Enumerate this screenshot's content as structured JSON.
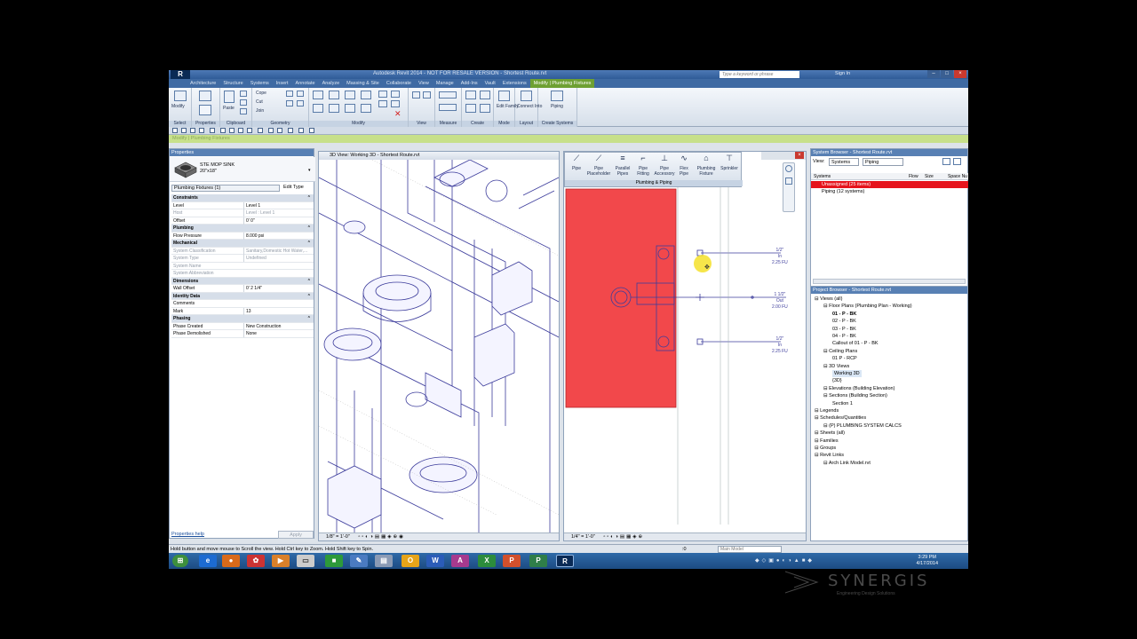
{
  "window": {
    "title": "Autodesk Revit 2014 - NOT FOR RESALE VERSION -   Shortest Route.rvt",
    "search_placeholder": "Type a keyword or phrase",
    "signin": "Sign In"
  },
  "tabs": [
    "Architecture",
    "Structure",
    "Systems",
    "Insert",
    "Annotate",
    "Analyze",
    "Massing & Site",
    "Collaborate",
    "View",
    "Manage",
    "Add-Ins",
    "Vault",
    "Extensions",
    "Modify | Plumbing Fixtures"
  ],
  "ribbon": {
    "modify": "Modify",
    "paste": "Paste",
    "cope": "Cope",
    "cut": "Cut",
    "join": "Join",
    "edit_family": "Edit Family",
    "connect_into": "Connect Into",
    "piping": "Piping",
    "groups": [
      "Select",
      "Properties",
      "Clipboard",
      "Geometry",
      "Modify",
      "View",
      "Measure",
      "Create",
      "Mode",
      "Layout",
      "Create Systems"
    ]
  },
  "option_bar": "Modify | Plumbing Fixtures",
  "properties": {
    "header": "Properties",
    "family_name": "STE MOP SINK",
    "family_size": "20\"x18\"",
    "selection": "Plumbing Fixtures (1)",
    "edit_type": "Edit Type",
    "rows": [
      {
        "k": "Constraints",
        "v": "",
        "cat": true
      },
      {
        "k": "Level",
        "v": "Level 1"
      },
      {
        "k": "Host",
        "v": "Level : Level 1",
        "dis": true
      },
      {
        "k": "Offset",
        "v": "0'  0\""
      },
      {
        "k": "Plumbing",
        "v": "",
        "cat": true
      },
      {
        "k": "Flow Pressure",
        "v": "8.000 psi"
      },
      {
        "k": "Mechanical",
        "v": "",
        "cat": true
      },
      {
        "k": "System Classification",
        "v": "Sanitary,Domestic Hot Water,...",
        "dis": true
      },
      {
        "k": "System Type",
        "v": "Undefined",
        "dis": true
      },
      {
        "k": "System Name",
        "v": "",
        "dis": true
      },
      {
        "k": "System Abbreviation",
        "v": "",
        "dis": true
      },
      {
        "k": "Dimensions",
        "v": "",
        "cat": true
      },
      {
        "k": "Wall Offset",
        "v": "0'  2 1/4\""
      },
      {
        "k": "Identity Data",
        "v": "",
        "cat": true
      },
      {
        "k": "Comments",
        "v": ""
      },
      {
        "k": "Mark",
        "v": "13"
      },
      {
        "k": "Phasing",
        "v": "",
        "cat": true
      },
      {
        "k": "Phase Created",
        "v": "New Construction"
      },
      {
        "k": "Phase Demolished",
        "v": "None"
      }
    ],
    "help": "Properties help",
    "apply": "Apply"
  },
  "view3d": {
    "title": "3D View: Working 3D - Shortest Route.rvt",
    "scale": "1/8\" = 1'-0\""
  },
  "plan": {
    "scale": "1/4\" = 1'-0\"",
    "tools": [
      {
        "label": "Pipe"
      },
      {
        "label": "Pipe Placeholder"
      },
      {
        "label": "Parallel Pipes"
      },
      {
        "label": "Pipe Fitting"
      },
      {
        "label": "Pipe Accessory"
      },
      {
        "label": "Flex Pipe"
      },
      {
        "label": "Plumbing Fixture"
      },
      {
        "label": "Sprinkler"
      }
    ],
    "group": "Plumbing & Piping",
    "tags": [
      {
        "a": "1/2\"",
        "b": "In",
        "c": "2.25 FU"
      },
      {
        "a": "1 1/2\"",
        "b": "Out",
        "c": "2.00 FU"
      },
      {
        "a": "1/2\"",
        "b": "In",
        "c": "2.25 FU"
      }
    ]
  },
  "system_browser": {
    "header": "System Browser - Shortest Route.rvt",
    "view_label": "View:",
    "view_value": "Systems",
    "filter_value": "Piping",
    "columns": [
      "Systems",
      "Flow",
      "Size",
      "Space Nu"
    ],
    "rows": [
      {
        "label": "Unassigned (25 items)",
        "red": true
      },
      {
        "label": "Piping (12 systems)",
        "red": false
      }
    ]
  },
  "project_browser": {
    "header": "Project Browser - Shortest Route.rvt",
    "items": [
      {
        "label": "Views (all)",
        "level": 0
      },
      {
        "label": "Floor Plans (Plumbing Plan - Working)",
        "level": 1
      },
      {
        "label": "01 - P - BK",
        "level": 2,
        "bold": true
      },
      {
        "label": "02 - P - BK",
        "level": 2
      },
      {
        "label": "03 - P - BK",
        "level": 2
      },
      {
        "label": "04 - P - BK",
        "level": 2
      },
      {
        "label": "Callout of 01 - P - BK",
        "level": 2
      },
      {
        "label": "Ceiling Plans",
        "level": 1
      },
      {
        "label": "01 P - RCP",
        "level": 2
      },
      {
        "label": "3D Views",
        "level": 1
      },
      {
        "label": "Working 3D",
        "level": 2,
        "hl": true
      },
      {
        "label": "{3D}",
        "level": 2
      },
      {
        "label": "Elevations (Building Elevation)",
        "level": 1
      },
      {
        "label": "Sections (Building Section)",
        "level": 1
      },
      {
        "label": "Section 1",
        "level": 2
      },
      {
        "label": "Legends",
        "level": 0
      },
      {
        "label": "Schedules/Quantities",
        "level": 0
      },
      {
        "label": "(P) PLUMBING SYSTEM CALCS",
        "level": 1
      },
      {
        "label": "Sheets (all)",
        "level": 0
      },
      {
        "label": "Families",
        "level": 0
      },
      {
        "label": "Groups",
        "level": 0
      },
      {
        "label": "Revit Links",
        "level": 0
      },
      {
        "label": "Arch Link Model.rvt",
        "level": 1
      }
    ]
  },
  "status": {
    "text": "Hold button and move mouse to Scroll the view. Hold Ctrl key to Zoom. Hold Shift key to Spin.",
    "zero": ":0",
    "model": "Main Model"
  },
  "clock": {
    "time": "3:29 PM",
    "date": "4/17/2014"
  },
  "watermark": {
    "brand": "SYNERGIS",
    "tagline": "Engineering Design Solutions"
  },
  "colors": {
    "accent_tab": "#6ea033",
    "unassigned_row": "#e6141c",
    "plan_fixture": "#f2484b",
    "title_bar": "#2f5c98"
  }
}
